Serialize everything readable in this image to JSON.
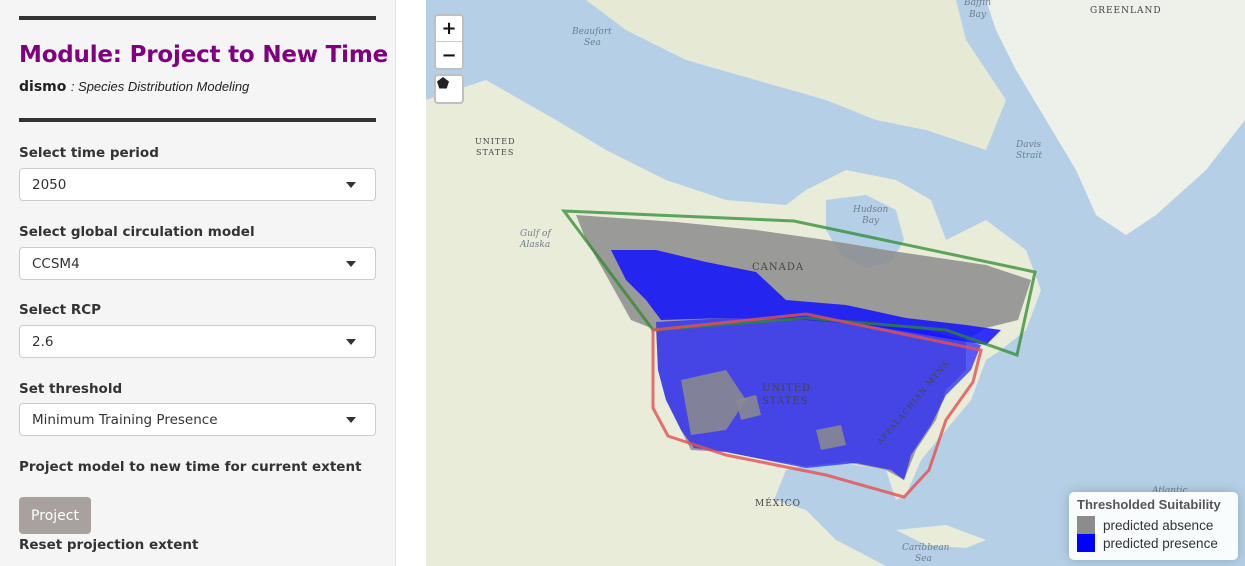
{
  "module": {
    "title": "Module: Project to New Time",
    "package": "dismo",
    "package_desc": ": Species Distribution Modeling"
  },
  "form": {
    "time_period": {
      "label": "Select time period",
      "value": "2050"
    },
    "gcm": {
      "label": "Select global circulation model",
      "value": "CCSM4"
    },
    "rcp": {
      "label": "Select RCP",
      "value": "2.6"
    },
    "threshold": {
      "label": "Set threshold",
      "value": "Minimum Training Presence"
    },
    "project_label": "Project model to new time for current extent",
    "project_button": "Project",
    "reset_label": "Reset projection extent"
  },
  "map": {
    "zoom_in": "+",
    "zoom_out": "−",
    "labels": {
      "greenland": "GREENLAND",
      "beaufort_1": "Beaufort",
      "beaufort_2": "Sea",
      "baffin_1": "Baffin",
      "baffin_2": "Bay",
      "us_alaska_1": "UNITED",
      "us_alaska_2": "STATES",
      "davis_1": "Davis",
      "davis_2": "Strait",
      "hudson_1": "Hudson",
      "hudson_2": "Bay",
      "alaska_gulf_1": "Gulf of",
      "alaska_gulf_2": "Alaska",
      "canada": "CANADA",
      "us_1": "UNITED",
      "us_2": "STATES",
      "appalachian": "APPALACHIAN MTNS",
      "mexico": "MÉXICO",
      "atlantic": "Atlantic",
      "caribbean_1": "Caribbean",
      "caribbean_2": "Sea"
    },
    "colors": {
      "water": "#b5d0e6",
      "land": "#e9ecd9",
      "absence": "#8c8c8c",
      "presence": "#0000ff",
      "extent_green": "#2e8b2e",
      "extent_red": "#e45050"
    }
  },
  "legend": {
    "title": "Thresholded Suitability",
    "items": [
      {
        "label": "predicted absence",
        "color": "#8c8c8c"
      },
      {
        "label": "predicted presence",
        "color": "#0000ff"
      }
    ]
  }
}
